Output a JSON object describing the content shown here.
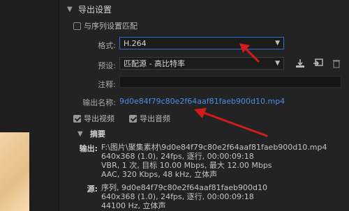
{
  "header": {
    "title": "导出设置"
  },
  "match_sequence": {
    "label": "与序列设置匹配",
    "checked": false
  },
  "format": {
    "label": "格式:",
    "value": "H.264"
  },
  "preset": {
    "label": "预设:",
    "value": "匹配源 - 高比特率"
  },
  "comments": {
    "label": "注释:",
    "value": ""
  },
  "output_name": {
    "label": "输出名称:",
    "value": "9d0e84f79c80e2f64aaf81faeb900d10.mp4"
  },
  "export_video": {
    "label": "导出视频",
    "checked": true
  },
  "export_audio": {
    "label": "导出音频",
    "checked": true
  },
  "summary": {
    "title": "摘要",
    "output_label": "输出:",
    "output_lines": [
      "F:\\图片\\聚集素材\\9d0e84f79c80e2f64aaf81faeb900d10.mp4",
      "640x368 (1.0), 24fps, 逐行, 00:00:09:18",
      "VBR, 1 次, 目标 10.00 Mbps, 最大 12.00 Mbps",
      "AAC, 320 Kbps, 48 kHz, 立体声"
    ],
    "source_label": "源:",
    "source_lines": [
      "序列, 9d0e84f79c80e2f64aaf81faeb900d10",
      "640x368 (1.0), 24fps, 逐行, 00:00:09:18",
      "44100 Hz, 立体声"
    ]
  },
  "icons": {
    "dropdown": "chevron-down",
    "save_preset": "download",
    "import_preset": "import",
    "delete_preset": "trash"
  },
  "colors": {
    "accent": "#2e6fd6",
    "link": "#4a8ee6",
    "annotation_arrow": "#d41b1b"
  }
}
